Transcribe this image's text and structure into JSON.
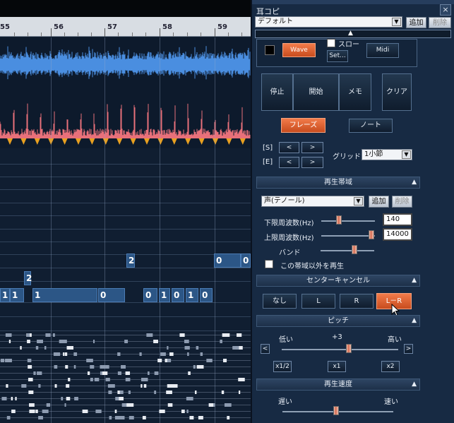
{
  "ruler": {
    "measures": [
      "55",
      "56",
      "57",
      "58",
      "59"
    ]
  },
  "notes": {
    "row1": [
      "2",
      "0",
      "0"
    ],
    "row2": [
      "2"
    ],
    "row3": [
      "1",
      "1",
      "1",
      "0",
      "0",
      "1",
      "0",
      "1",
      "0"
    ]
  },
  "panel": {
    "title": "耳コピ",
    "close_label": "×",
    "preset_select": "デフォルト",
    "add_label": "追加",
    "delete_label": "削除",
    "wave_label": "Wave",
    "slow_label": "スロー",
    "set_label": "Set...",
    "midi_label": "Midi",
    "stop_label": "停止",
    "start_label": "開始",
    "memo_label": "メモ",
    "clear_label": "クリア",
    "phrase_label": "フレーズ",
    "note_label": "ノート",
    "s_label": "[S]",
    "e_label": "[E]",
    "grid_label": "グリッド",
    "grid_value": "1小節",
    "band_section": "再生帯域",
    "band_select": "声(テノール)",
    "band_add_label": "追加",
    "band_delete_label": "削除",
    "lower_freq_label": "下限周波数(Hz)",
    "lower_freq_value": "140",
    "upper_freq_label": "上限周波数(Hz)",
    "upper_freq_value": "14000",
    "band_label": "バンド",
    "outside_band_label": "この帯域以外を再生",
    "center_cancel_section": "センターキャンセル",
    "cc_none": "なし",
    "cc_l": "L",
    "cc_r": "R",
    "cc_lr": "L－R",
    "pitch_section": "ピッチ",
    "pitch_low": "低い",
    "pitch_value": "+3",
    "pitch_high": "高い",
    "pitch_x_half": "x1/2",
    "pitch_x1": "x1",
    "pitch_x2": "x2",
    "speed_section": "再生速度",
    "speed_slow": "遅い",
    "speed_fast": "速い"
  },
  "colors": {
    "wave": "#4a8ee0",
    "spectrum": "#e8707a",
    "marker": "#e8a020",
    "accent_orange": "#e0602c"
  }
}
